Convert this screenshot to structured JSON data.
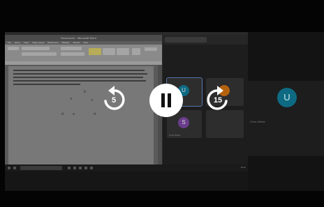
{
  "overlay": {
    "rewind_seconds": "5",
    "forward_seconds": "15"
  },
  "shared_screen": {
    "word": {
      "title": "Document1 - Microsoft Word",
      "tabs": [
        "File",
        "Home",
        "Insert",
        "Page Layout",
        "References",
        "Mailings",
        "Review",
        "View"
      ]
    },
    "meeting": {
      "tile_avatars": [
        "U",
        "S"
      ],
      "tile_label": "Chris Wiebe"
    },
    "taskbar": {
      "search_placeholder": "Type here to search",
      "tray_time": "10:21"
    }
  },
  "sidebar": {
    "avatar_letter": "U",
    "participant_name": "Chris Wiebe"
  }
}
